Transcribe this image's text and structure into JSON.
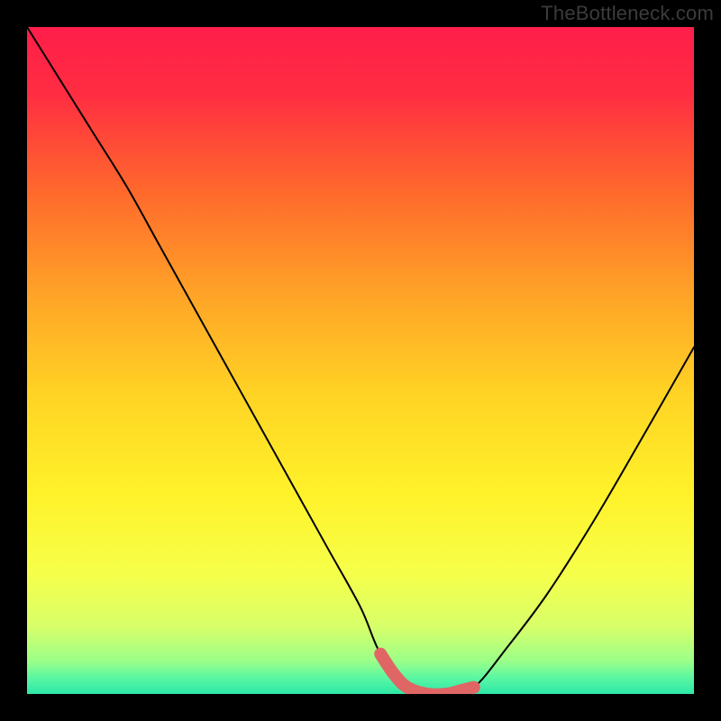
{
  "watermark": "TheBottleneck.com",
  "chart_data": {
    "type": "line",
    "title": "",
    "xlabel": "",
    "ylabel": "",
    "xlim": [
      0,
      100
    ],
    "ylim": [
      0,
      100
    ],
    "grid": false,
    "legend": false,
    "series": [
      {
        "name": "bottleneck-curve",
        "x": [
          0,
          5,
          10,
          15,
          20,
          25,
          30,
          35,
          40,
          45,
          50,
          53,
          57,
          60,
          63,
          67,
          72,
          78,
          85,
          92,
          100
        ],
        "y": [
          100,
          92,
          84,
          76,
          67,
          58,
          49,
          40,
          31,
          22,
          13,
          6,
          1,
          0,
          0,
          1,
          7,
          15,
          26,
          38,
          52
        ]
      }
    ],
    "highlight_segment": {
      "name": "bottom-highlight",
      "x": [
        53,
        55,
        57,
        60,
        63,
        65,
        67
      ],
      "y": [
        6,
        3,
        1,
        0,
        0,
        0.5,
        1
      ]
    },
    "gradient_stops": [
      {
        "offset": 0.0,
        "color": "#ff1e4a"
      },
      {
        "offset": 0.1,
        "color": "#ff2d42"
      },
      {
        "offset": 0.25,
        "color": "#ff6a2c"
      },
      {
        "offset": 0.4,
        "color": "#ffa327"
      },
      {
        "offset": 0.55,
        "color": "#ffd324"
      },
      {
        "offset": 0.7,
        "color": "#fff22a"
      },
      {
        "offset": 0.82,
        "color": "#f6ff4a"
      },
      {
        "offset": 0.9,
        "color": "#d7ff6a"
      },
      {
        "offset": 0.95,
        "color": "#9cff88"
      },
      {
        "offset": 0.975,
        "color": "#5cf7a2"
      },
      {
        "offset": 1.0,
        "color": "#2de8a8"
      }
    ]
  }
}
